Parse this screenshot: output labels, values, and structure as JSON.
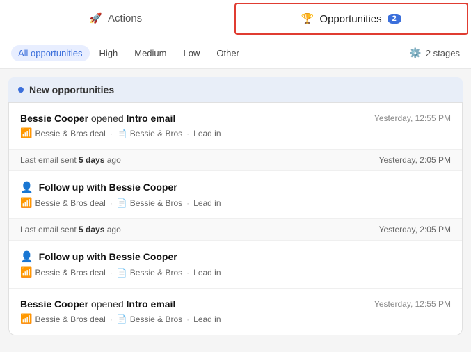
{
  "topNav": {
    "actions": {
      "label": "Actions",
      "icon": "rocket-icon"
    },
    "opportunities": {
      "label": "Opportunities",
      "badge": "2",
      "icon": "opportunities-icon"
    }
  },
  "filters": {
    "items": [
      {
        "label": "All opportunities",
        "active": true
      },
      {
        "label": "High",
        "active": false
      },
      {
        "label": "Medium",
        "active": false
      },
      {
        "label": "Low",
        "active": false
      },
      {
        "label": "Other",
        "active": false
      }
    ],
    "stages": "2 stages"
  },
  "section": {
    "title": "New opportunities"
  },
  "cards": [
    {
      "type": "activity",
      "title_prefix": "",
      "title": "Bessie Cooper",
      "title_action": "opened",
      "title_object": "Intro email",
      "time": "Yesterday, 12:55 PM",
      "signal": "green",
      "deal": "Bessie & Bros deal",
      "company": "Bessie & Bros",
      "stage": "Lead in"
    },
    {
      "type": "separator",
      "last_email": "Last email sent",
      "days": "5 days",
      "days_suffix": "ago",
      "time": "Yesterday, 2:05 PM"
    },
    {
      "type": "followup",
      "title": "Follow up with Bessie Cooper",
      "time": "",
      "signal": "green",
      "deal": "Bessie & Bros deal",
      "company": "Bessie & Bros",
      "stage": "Lead in"
    },
    {
      "type": "separator",
      "last_email": "Last email sent",
      "days": "5 days",
      "days_suffix": "ago",
      "time": "Yesterday, 2:05 PM"
    },
    {
      "type": "followup",
      "title": "Follow up with Bessie Cooper",
      "time": "",
      "signal": "red",
      "deal": "Bessie & Bros deal",
      "company": "Bessie & Bros",
      "stage": "Lead in"
    },
    {
      "type": "activity",
      "title": "Bessie Cooper",
      "title_action": "opened",
      "title_object": "Intro email",
      "time": "Yesterday, 12:55 PM",
      "signal": "yellow",
      "deal": "Bessie & Bros deal",
      "company": "Bessie & Bros",
      "stage": "Lead in"
    }
  ]
}
